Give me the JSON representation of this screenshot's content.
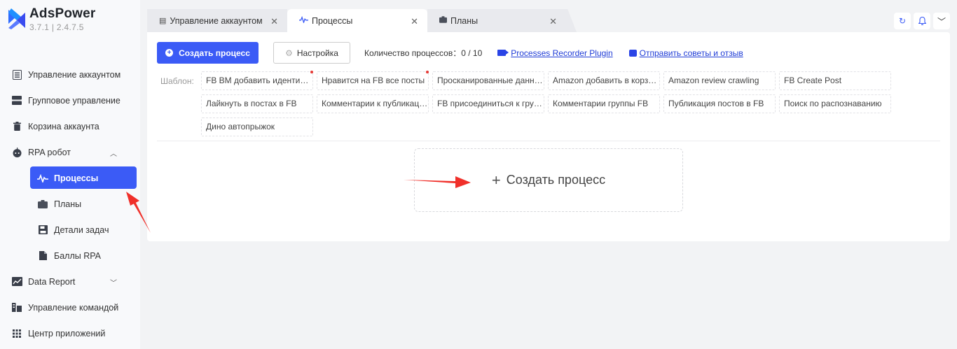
{
  "app": {
    "name": "AdsPower",
    "version": "3.7.1  |  2.4.7.5"
  },
  "sidebar": {
    "items": [
      {
        "label": "Управление аккаунтом",
        "icon": "account-list-icon"
      },
      {
        "label": "Групповое управление",
        "icon": "group-icon"
      },
      {
        "label": "Корзина аккаунта",
        "icon": "trash-icon"
      },
      {
        "label": "RPA робот",
        "icon": "robot-icon",
        "expanded": true
      },
      {
        "label": "Процессы",
        "icon": "pulse-icon",
        "active": true
      },
      {
        "label": "Планы",
        "icon": "briefcase-icon"
      },
      {
        "label": "Детали задач",
        "icon": "save-icon"
      },
      {
        "label": "Баллы RPA",
        "icon": "document-icon"
      },
      {
        "label": "Data Report",
        "icon": "chart-icon"
      },
      {
        "label": "Управление командой",
        "icon": "team-icon"
      },
      {
        "label": "Центр приложений",
        "icon": "apps-grid-icon"
      }
    ]
  },
  "tabs": [
    {
      "label": "Управление аккаунтом",
      "icon": "list-icon"
    },
    {
      "label": "Процессы",
      "icon": "pulse-icon",
      "active": true
    },
    {
      "label": "Планы",
      "icon": "briefcase-icon"
    }
  ],
  "toolbar": {
    "create_label": "Создать процесс",
    "settings_label": "Настройка",
    "process_count": "Количество процессов：0 / 10",
    "recorder_link": "Processes Recorder Plugin",
    "feedback_link": "Отправить советы и отзыв"
  },
  "templates": {
    "label": "Шаблон:",
    "items": [
      "FB BM добавить идентификатор",
      "Нравится на FB все посты",
      "Просканированные данные",
      "Amazon добавить в корзину",
      "Amazon review crawling",
      "FB Create Post",
      "Лайкнуть в постах в FB",
      "Комментарии к публикациям",
      "FB присоединиться к группе",
      "Комментарии группы FB",
      "Публикация постов в FB",
      "Поиск по распознаванию",
      "Дино автопрыжок"
    ]
  },
  "create_box": {
    "label": "Создать процесс"
  },
  "colors": {
    "accent": "#3b5bf6",
    "annotation_arrow": "#f0302a",
    "new_dot": "#e53935"
  }
}
